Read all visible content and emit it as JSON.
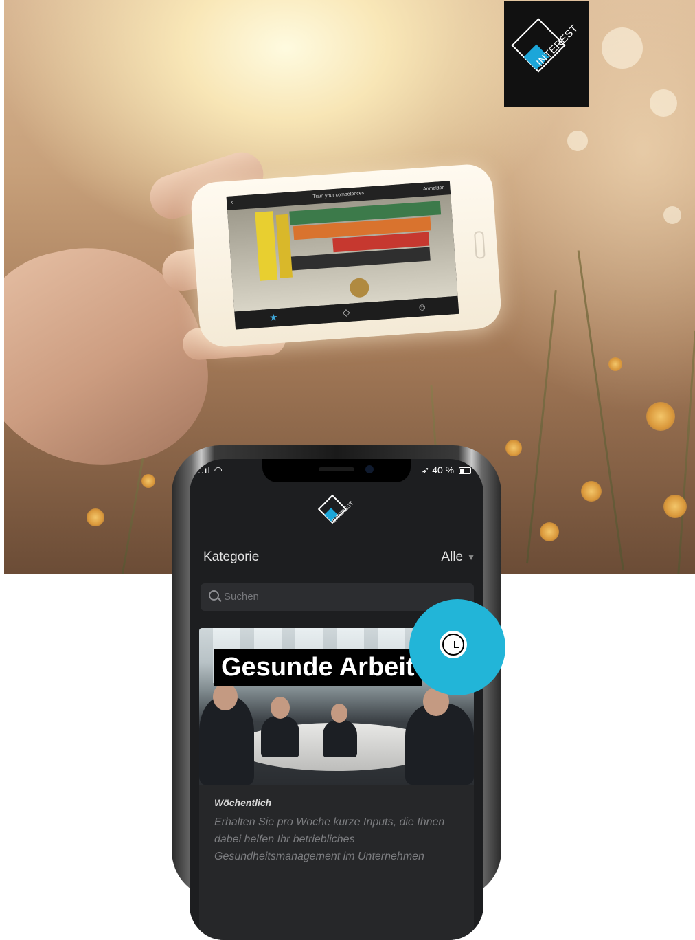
{
  "brand": {
    "logo_text": "INTEREST",
    "accent": "#1ca6d9"
  },
  "photo_phone": {
    "title": "Train your competences",
    "login": "Anmelden",
    "back_glyph": "‹",
    "tab_icons": [
      "star-icon",
      "logo-icon",
      "user-icon"
    ]
  },
  "status_bar": {
    "signal": "..ıl",
    "battery": "40 %"
  },
  "app": {
    "logo_text": "INTEREST",
    "category_label": "Kategorie",
    "category_value": "Alle",
    "search_placeholder": "Suchen",
    "card": {
      "title": "Gesunde Arbeit",
      "frequency": "Wöchentlich",
      "description": "Erhalten Sie pro Woche kurze Inputs, die Ihnen dabei helfen Ihr betriebliches Gesundheitsmanagement im Unternehmen"
    },
    "badge_icon": "clock-icon",
    "badge_color": "#22b5d8"
  }
}
